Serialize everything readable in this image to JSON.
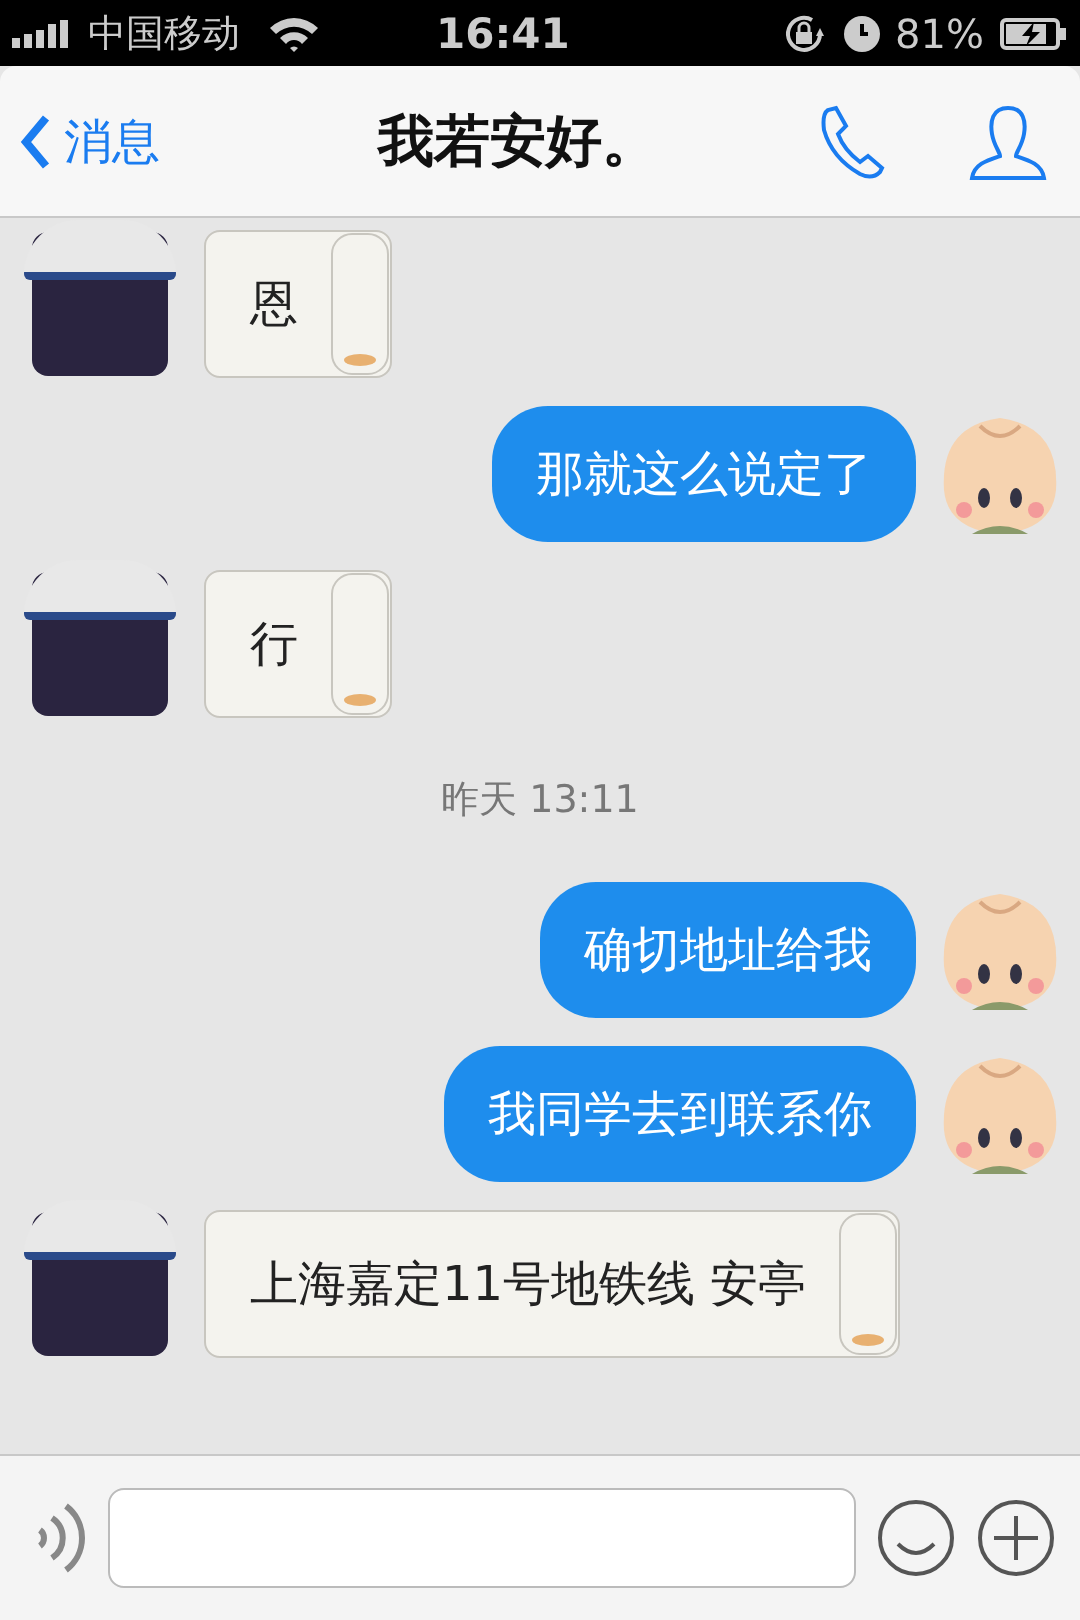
{
  "status_bar": {
    "carrier": "中国移动",
    "time": "16:41",
    "battery": "81%"
  },
  "nav": {
    "back": "消息",
    "title": "我若安好。"
  },
  "messages": [
    {
      "kind": "received",
      "text": "恩"
    },
    {
      "kind": "sent",
      "text": "那就这么说定了"
    },
    {
      "kind": "received",
      "text": "行"
    },
    {
      "kind": "time",
      "text": "昨天 13:11"
    },
    {
      "kind": "sent",
      "text": "确切地址给我"
    },
    {
      "kind": "sent",
      "text": "我同学去到联系你"
    },
    {
      "kind": "received",
      "text": "上海嘉定11号地铁线 安亭"
    }
  ]
}
